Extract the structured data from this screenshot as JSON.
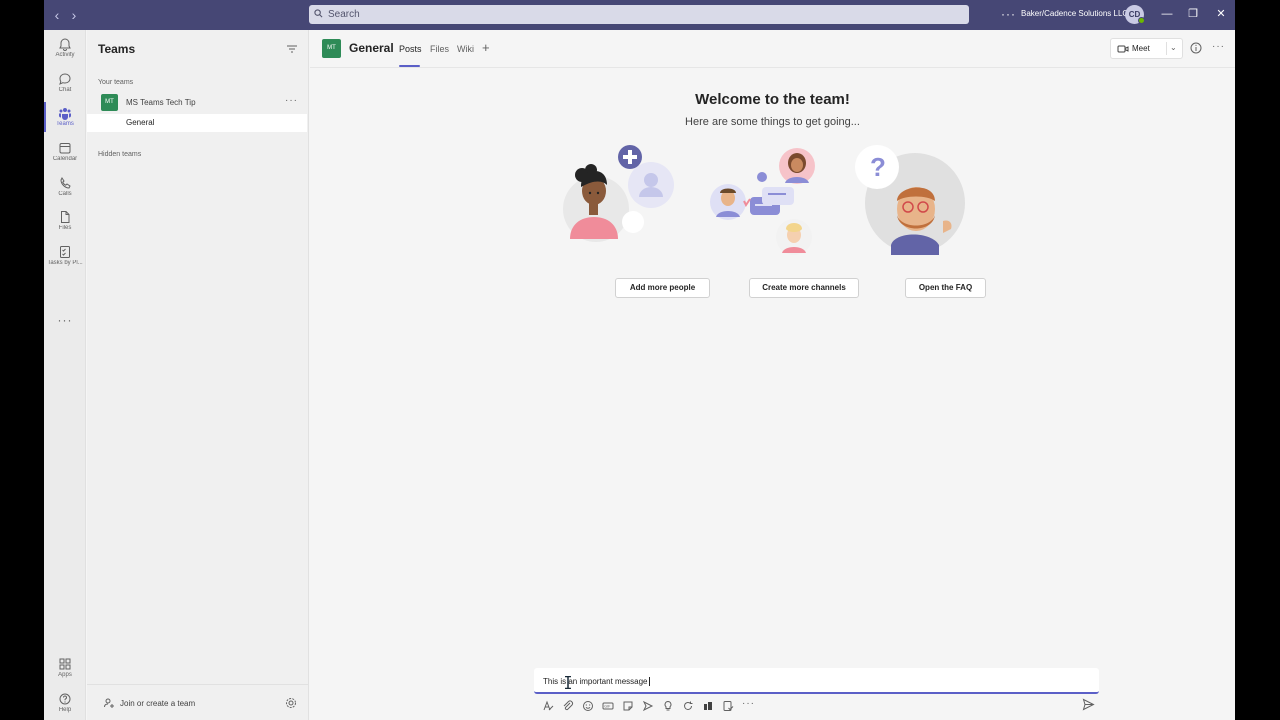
{
  "titlebar": {
    "search_placeholder": "Search",
    "more": "···",
    "org_name": "Baker/Cadence Solutions LLC",
    "user_initials": "CD"
  },
  "rail": {
    "items": [
      {
        "label": "Activity",
        "icon": "bell-icon"
      },
      {
        "label": "Chat",
        "icon": "chat-icon"
      },
      {
        "label": "Teams",
        "icon": "teams-icon"
      },
      {
        "label": "Calendar",
        "icon": "calendar-icon"
      },
      {
        "label": "Calls",
        "icon": "phone-icon"
      },
      {
        "label": "Files",
        "icon": "file-icon"
      },
      {
        "label": "Tasks by Pl...",
        "icon": "tasks-icon"
      }
    ],
    "more": "···",
    "bottom": [
      {
        "label": "Apps",
        "icon": "apps-icon"
      },
      {
        "label": "Help",
        "icon": "help-icon"
      }
    ]
  },
  "teams_pane": {
    "title": "Teams",
    "your_teams_label": "Your teams",
    "team": {
      "initials": "MT",
      "name": "MS Teams Tech Tip",
      "more": "···"
    },
    "channel": "General",
    "hidden_teams_label": "Hidden teams",
    "join_label": "Join or create a team"
  },
  "channel": {
    "initials": "MT",
    "name": "General",
    "tabs": [
      "Posts",
      "Files",
      "Wiki"
    ],
    "active_tab": "Posts",
    "add_tab": "+",
    "meet_label": "Meet",
    "more": "···"
  },
  "welcome": {
    "title": "Welcome to the team!",
    "subtitle": "Here are some things to get going...",
    "actions": [
      "Add more people",
      "Create more channels",
      "Open the FAQ"
    ]
  },
  "compose": {
    "text": "This is an important message",
    "toolbar_icons": [
      "format-icon",
      "attach-icon",
      "emoji-icon",
      "gif-icon",
      "sticker-icon",
      "schedule-meeting-icon",
      "praise-icon",
      "loop-icon",
      "stream-icon",
      "approvals-icon",
      "more-icon"
    ]
  }
}
